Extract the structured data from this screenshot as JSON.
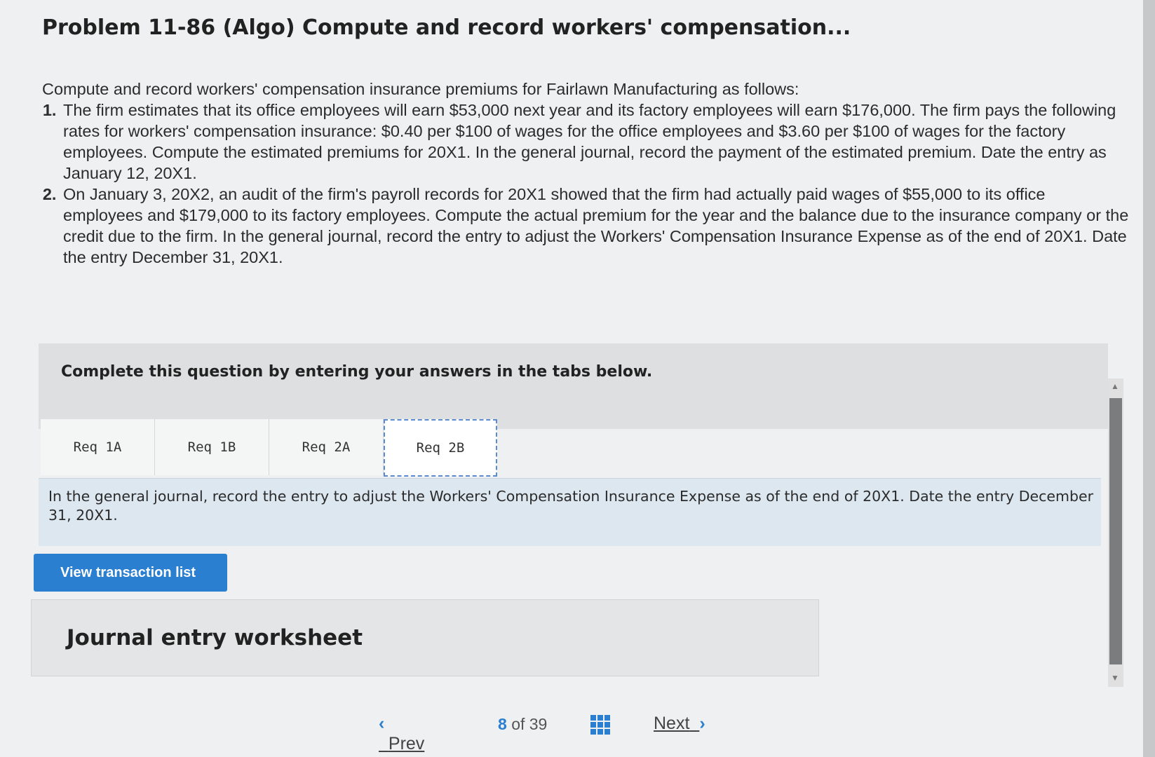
{
  "page": {
    "title": "Problem 11-86 (Algo) Compute and record workers' compensation..."
  },
  "problem": {
    "intro": "Compute and record workers' compensation insurance premiums for Fairlawn Manufacturing as follows:",
    "items": [
      "The firm estimates that its office employees will earn $53,000 next year and its factory employees will earn $176,000. The firm pays the following rates for workers' compensation insurance: $0.40 per $100 of wages for the office employees and $3.60 per $100 of wages for the factory employees. Compute the estimated premiums for 20X1. In the general journal, record the payment of the estimated premium. Date the entry as January 12, 20X1.",
      "On January 3, 20X2, an audit of the firm's payroll records for 20X1 showed that the firm had actually paid wages of $55,000 to its office employees and $179,000 to its factory employees. Compute the actual premium for the year and the balance due to the insurance company or the credit due to the firm. In the general journal, record the entry to adjust the Workers' Compensation Insurance Expense as of the end of 20X1. Date the entry December 31, 20X1."
    ]
  },
  "complete_prompt": "Complete this question by entering your answers in the tabs below.",
  "tabs": [
    {
      "label": "Req 1A"
    },
    {
      "label": "Req 1B"
    },
    {
      "label": "Req 2A"
    },
    {
      "label": "Req 2B"
    }
  ],
  "active_tab": "Req 2B",
  "req_instruction": "In the general journal, record the entry to adjust the Workers' Compensation Insurance Expense as of the end of 20X1. Date the entry December 31, 20X1.",
  "buttons": {
    "view_transactions": "View transaction list"
  },
  "worksheet": {
    "title": "Journal entry worksheet"
  },
  "pager": {
    "prev": "Prev",
    "current": "8",
    "of": "of",
    "total": "39",
    "next": "Next"
  },
  "colors": {
    "accent": "#2b7fd0",
    "banner": "#dde7f0"
  }
}
